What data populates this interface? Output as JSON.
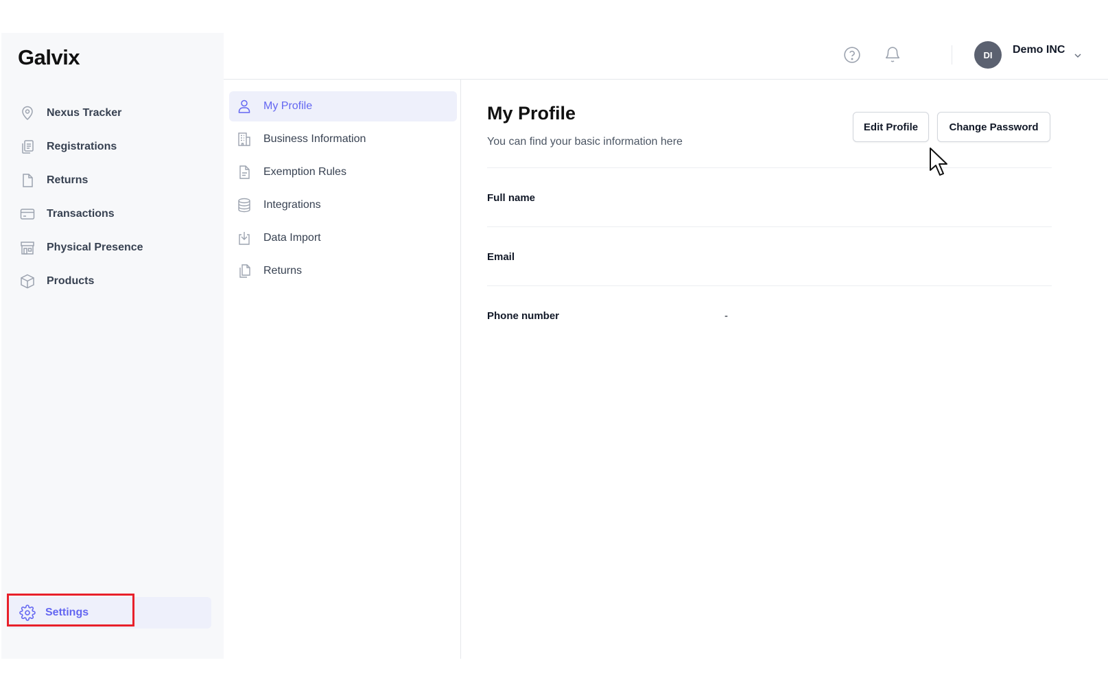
{
  "app": {
    "logo": "Galvix"
  },
  "sidebar": {
    "items": [
      {
        "label": "Nexus Tracker",
        "icon": "location-pin-icon"
      },
      {
        "label": "Registrations",
        "icon": "clipboard-icon"
      },
      {
        "label": "Returns",
        "icon": "document-icon"
      },
      {
        "label": "Transactions",
        "icon": "credit-card-icon"
      },
      {
        "label": "Physical Presence",
        "icon": "storefront-icon"
      },
      {
        "label": "Products",
        "icon": "box-icon"
      }
    ],
    "settings": {
      "label": "Settings",
      "icon": "gear-icon",
      "active": true
    }
  },
  "header": {
    "help_icon": "help-circle-icon",
    "notifications_icon": "bell-icon",
    "avatar_initials": "DI",
    "org_name": "Demo INC"
  },
  "settings_nav": {
    "items": [
      {
        "label": "My Profile",
        "icon": "user-icon",
        "active": true
      },
      {
        "label": "Business Information",
        "icon": "building-icon"
      },
      {
        "label": "Exemption Rules",
        "icon": "file-text-icon"
      },
      {
        "label": "Integrations",
        "icon": "database-icon"
      },
      {
        "label": "Data Import",
        "icon": "download-icon"
      },
      {
        "label": "Returns",
        "icon": "copy-icon"
      }
    ]
  },
  "main": {
    "title": "My Profile",
    "subtitle": "You can find your basic information here",
    "edit_button": "Edit Profile",
    "change_password_button": "Change Password",
    "fields": [
      {
        "label": "Full name",
        "value": ""
      },
      {
        "label": "Email",
        "value": ""
      },
      {
        "label": "Phone number",
        "value": "-"
      }
    ]
  },
  "colors": {
    "accent": "#6366f1",
    "highlight_border": "#e8202a",
    "active_bg": "#eef0fb",
    "sidebar_bg": "#f7f8fa"
  }
}
